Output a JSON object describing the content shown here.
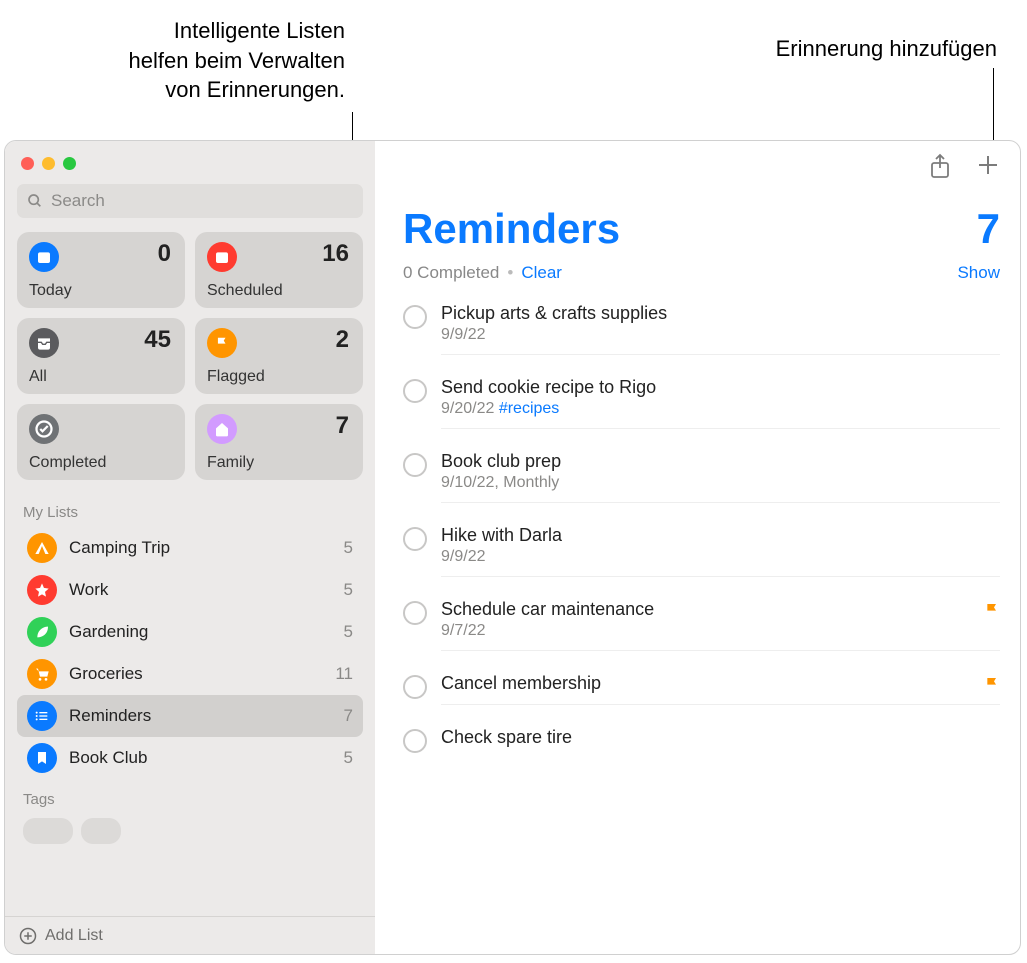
{
  "callouts": {
    "smart_lists": "Intelligente Listen\nhelfen beim Verwalten\nvon Erinnerungen.",
    "add_reminder": "Erinnerung hinzufügen"
  },
  "search": {
    "placeholder": "Search"
  },
  "smart_lists": {
    "today": {
      "label": "Today",
      "count": "0",
      "color": "#0a7aff"
    },
    "scheduled": {
      "label": "Scheduled",
      "count": "16",
      "color": "#ff3b30"
    },
    "all": {
      "label": "All",
      "count": "45",
      "color": "#5b5b5e"
    },
    "flagged": {
      "label": "Flagged",
      "count": "2",
      "color": "#ff9500"
    },
    "completed": {
      "label": "Completed",
      "count": "",
      "color": "#6f7275"
    },
    "family": {
      "label": "Family",
      "count": "7",
      "color": "#d29bff"
    }
  },
  "sections": {
    "my_lists": "My Lists",
    "tags": "Tags"
  },
  "my_lists": [
    {
      "name": "Camping Trip",
      "count": "5",
      "color": "#ff9500",
      "icon": "tent",
      "selected": false
    },
    {
      "name": "Work",
      "count": "5",
      "color": "#ff3b30",
      "icon": "star",
      "selected": false
    },
    {
      "name": "Gardening",
      "count": "5",
      "color": "#30d158",
      "icon": "leaf",
      "selected": false
    },
    {
      "name": "Groceries",
      "count": "11",
      "color": "#ff9500",
      "icon": "cart",
      "selected": false
    },
    {
      "name": "Reminders",
      "count": "7",
      "color": "#0a7aff",
      "icon": "list",
      "selected": true
    },
    {
      "name": "Book Club",
      "count": "5",
      "color": "#0a7aff",
      "icon": "bookmark",
      "selected": false
    }
  ],
  "add_list": "Add List",
  "main": {
    "title": "Reminders",
    "count": "7",
    "completed_text": "0 Completed",
    "clear": "Clear",
    "show": "Show"
  },
  "reminders": [
    {
      "title": "Pickup arts & crafts supplies",
      "sub": "9/9/22",
      "tag": "",
      "flagged": false
    },
    {
      "title": "Send cookie recipe to Rigo",
      "sub": "9/20/22",
      "tag": "#recipes",
      "flagged": false
    },
    {
      "title": "Book club prep",
      "sub": "9/10/22, Monthly",
      "tag": "",
      "flagged": false
    },
    {
      "title": "Hike with Darla",
      "sub": "9/9/22",
      "tag": "",
      "flagged": false
    },
    {
      "title": "Schedule car maintenance",
      "sub": "9/7/22",
      "tag": "",
      "flagged": true
    },
    {
      "title": "Cancel membership",
      "sub": "",
      "tag": "",
      "flagged": true
    },
    {
      "title": "Check spare tire",
      "sub": "",
      "tag": "",
      "flagged": false
    }
  ]
}
